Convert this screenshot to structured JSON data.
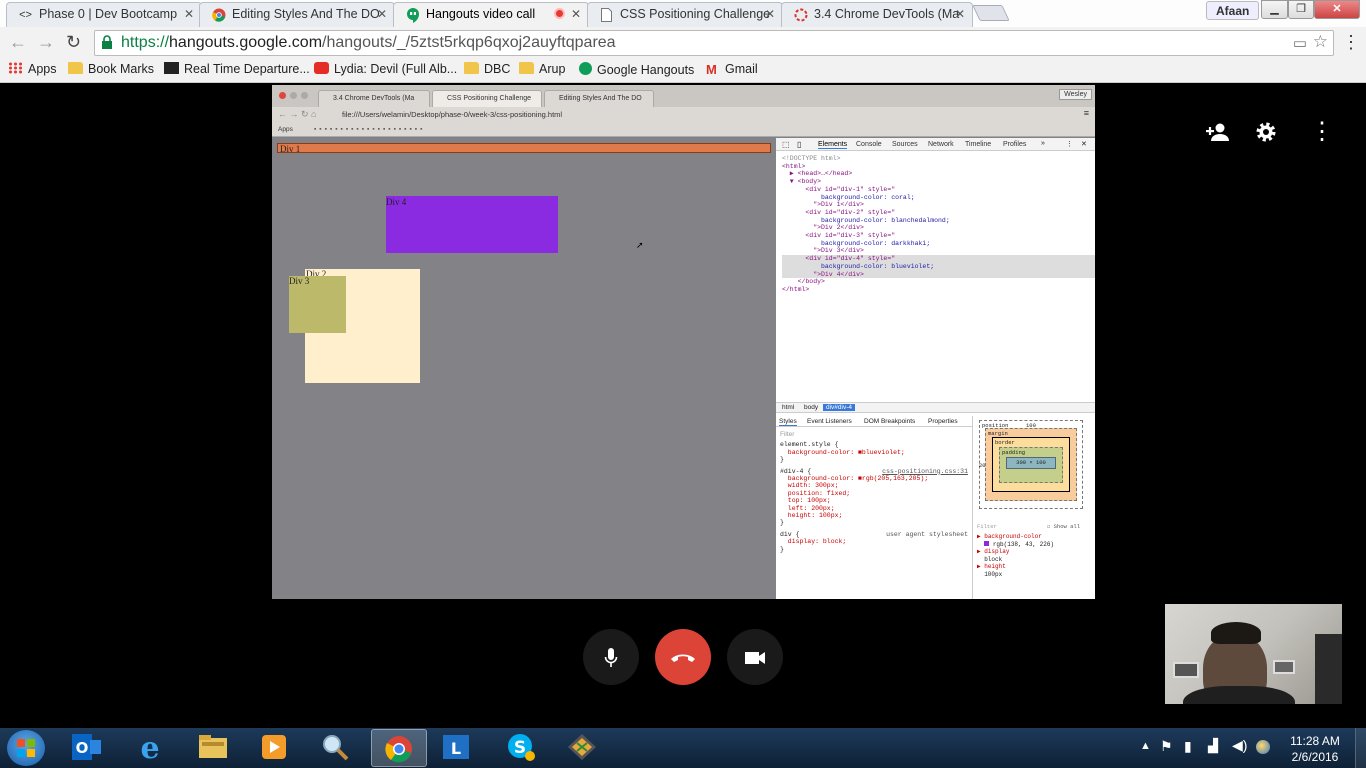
{
  "browser": {
    "tabs": [
      {
        "label": "Phase 0 | Dev Bootcamp",
        "favicon": "code-icon"
      },
      {
        "label": "Editing Styles And The DO",
        "favicon": "chrome-icon"
      },
      {
        "label": "Hangouts video call",
        "favicon": "hangouts-icon",
        "active": true
      },
      {
        "label": "CSS Positioning Challenge",
        "favicon": "page-icon"
      },
      {
        "label": "3.4 Chrome DevTools (Ma",
        "favicon": "loading-icon"
      }
    ],
    "profile": "Afaan",
    "url_scheme": "https://",
    "url_host": "hangouts.google.com",
    "url_path": "/hangouts/_/5ztst5rkqp6qxoj2auyftqparea"
  },
  "bookmarks": [
    {
      "label": "Apps",
      "icon": "apps-icon"
    },
    {
      "label": "Book Marks",
      "icon": "folder-icon"
    },
    {
      "label": "Real Time Departure...",
      "icon": "transit-icon"
    },
    {
      "label": "Lydia: Devil (Full Alb...",
      "icon": "youtube-icon"
    },
    {
      "label": "DBC",
      "icon": "folder-icon"
    },
    {
      "label": "Arup",
      "icon": "folder-icon"
    },
    {
      "label": "Google Hangouts",
      "icon": "hangouts-icon"
    },
    {
      "label": "Gmail",
      "icon": "gmail-icon"
    }
  ],
  "shared_screen": {
    "tabs": [
      "3.4 Chrome DevTools (Ma",
      "CSS Positioning Challenge",
      "Editing Styles And The DO"
    ],
    "user": "Wesley",
    "url": "file:///Users/welamin/Desktop/phase-0/week-3/css-positioning.html",
    "bookmark_apps": "Apps",
    "page": {
      "div1": "Div 1",
      "div2": "Div 2",
      "div3": "Div 3",
      "div4": "Div 4"
    },
    "devtools": {
      "tabs": [
        "Elements",
        "Console",
        "Sources",
        "Network",
        "Timeline",
        "Profiles"
      ],
      "dom": [
        "<!DOCTYPE html>",
        "<html>",
        "  ▶ <head>…</head>",
        "  ▼ <body>",
        "      <div id=\"div-1\" style=\"",
        "          background-color: coral;",
        "        \">Div 1</div>",
        "      <div id=\"div-2\" style=\"",
        "          background-color: blanchedalmond;",
        "        \">Div 2</div>",
        "      <div id=\"div-3\" style=\"",
        "          background-color: darkkhaki;",
        "        \">Div 3</div>",
        "      <div id=\"div-4\" style=\"",
        "          background-color: blueviolet;",
        "        \">Div 4</div>",
        "    </body>",
        "</html>"
      ],
      "breadcrumbs": [
        "html",
        "body",
        "div#div-4"
      ],
      "subtabs": [
        "Styles",
        "Event Listeners",
        "DOM Breakpoints",
        "Properties"
      ],
      "filter_placeholder": "Filter",
      "styles": [
        "element.style {",
        "  background-color: ■blueviolet;",
        "}",
        "#div-4 {",
        "  background-color: ■rgb(205,163,205);",
        "  width: 300px;",
        "  position: fixed;",
        "  top: 100px;",
        "  left: 200px;",
        "  height: 100px;",
        "}",
        "div {",
        "  display: block;",
        "}"
      ],
      "style_source": "css-positioning.css:31",
      "ua_label": "user agent stylesheet",
      "box_position_label": "position",
      "box_position_top": "100",
      "box_position_left": "200",
      "box_margin": "margin",
      "box_border": "border",
      "box_padding": "padding",
      "box_content": "300 × 100",
      "computed_filter": "Filter",
      "show_all": "Show all",
      "computed": [
        {
          "prop": "background-color",
          "value": "rgb(138, 43, 226)"
        },
        {
          "prop": "display",
          "value": "block"
        },
        {
          "prop": "height",
          "value": "100px"
        }
      ]
    }
  },
  "taskbar": {
    "time": "11:28 AM",
    "date": "2/6/2016"
  },
  "colors": {
    "coral": "#e07a4a",
    "blanchedalmond": "#ffefcd",
    "darkkhaki": "#bdb96a",
    "blueviolet": "#8a2be2",
    "hangup": "#db4437"
  }
}
